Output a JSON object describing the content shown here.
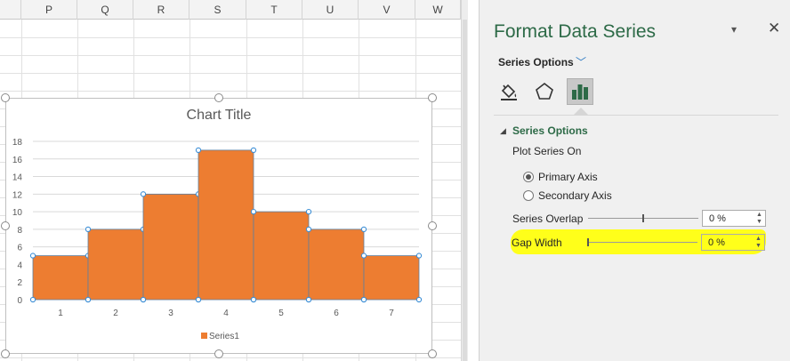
{
  "sheet": {
    "columns": [
      "P",
      "Q",
      "R",
      "S",
      "T",
      "U",
      "V",
      "W"
    ]
  },
  "chart": {
    "title": "Chart Title"
  },
  "chart_data": {
    "type": "bar",
    "title": "Chart Title",
    "categories": [
      "1",
      "2",
      "3",
      "4",
      "5",
      "6",
      "7"
    ],
    "series": [
      {
        "name": "Series1",
        "values": [
          5,
          8,
          12,
          17,
          10,
          8,
          5
        ],
        "color": "#ed7d31"
      }
    ],
    "ylim": [
      0,
      18
    ],
    "yticks": [
      0,
      2,
      4,
      6,
      8,
      10,
      12,
      14,
      16,
      18
    ],
    "grid": true,
    "legend": "bottom",
    "gap_width_percent": 0
  },
  "pane": {
    "title": "Format Data Series",
    "dropdown_icon": "chevron-down-icon",
    "close_label": "✕",
    "series_options_label": "Series Options",
    "icons": [
      "fill-line-icon",
      "effects-icon",
      "series-options-icon"
    ],
    "section_title": "Series Options",
    "plot_on_label": "Plot Series On",
    "primary_axis": "Primary Axis",
    "secondary_axis": "Secondary Axis",
    "overlap_label": "Series Overlap",
    "overlap_value": "0 %",
    "overlap_percent": 0,
    "gap_label": "Gap Width",
    "gap_value": "0 %",
    "gap_percent": 0,
    "selected_axis": "primary"
  },
  "colors": {
    "accent": "#2d6a47",
    "bar": "#ed7d31",
    "highlight": "#ffff1a"
  }
}
